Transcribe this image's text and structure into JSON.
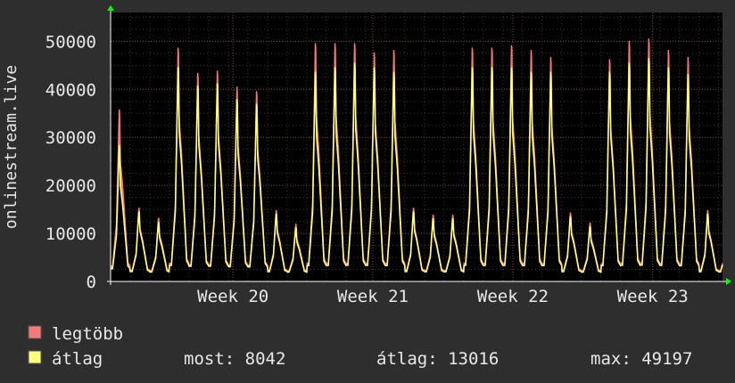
{
  "chart_data": {
    "type": "area",
    "ylabel": "onlinestream.live",
    "ylim": [
      0,
      56000
    ],
    "yticks": [
      0,
      10000,
      20000,
      30000,
      40000,
      50000
    ],
    "xlim": [
      0,
      31.2
    ],
    "xticks": [
      {
        "label": "Week 20",
        "x": 6.24
      },
      {
        "label": "Week 21",
        "x": 13.37
      },
      {
        "label": "Week 22",
        "x": 20.51
      },
      {
        "label": "Week 23",
        "x": 27.64
      }
    ],
    "grid": true,
    "colors": {
      "background": "#2e2e2e",
      "plot": "#000000",
      "grid": "#6a4444",
      "max": "#f47b7b",
      "avg": "#fdfd7e",
      "axis_arrow": "#00ff00"
    },
    "series": [
      {
        "name": "legtöbb",
        "color": "#f47b7b"
      },
      {
        "name": "átlag",
        "color": "#fdfd7e"
      }
    ],
    "days": [
      {
        "day": 0,
        "peak_max": 37500,
        "peak_avg": 30000
      },
      {
        "day": 1,
        "peak_max": 16000,
        "peak_avg": 15500
      },
      {
        "day": 2,
        "peak_max": 13800,
        "peak_avg": 13200
      },
      {
        "day": 3,
        "peak_max": 51000,
        "peak_avg": 47000
      },
      {
        "day": 4,
        "peak_max": 45500,
        "peak_avg": 43000
      },
      {
        "day": 5,
        "peak_max": 46000,
        "peak_avg": 43500
      },
      {
        "day": 6,
        "peak_max": 42500,
        "peak_avg": 40000
      },
      {
        "day": 7,
        "peak_max": 41500,
        "peak_avg": 39000
      },
      {
        "day": 8,
        "peak_max": 15500,
        "peak_avg": 15000
      },
      {
        "day": 9,
        "peak_max": 12500,
        "peak_avg": 12000
      },
      {
        "day": 10,
        "peak_max": 52000,
        "peak_avg": 46000
      },
      {
        "day": 11,
        "peak_max": 52000,
        "peak_avg": 47000
      },
      {
        "day": 12,
        "peak_max": 52000,
        "peak_avg": 48000
      },
      {
        "day": 13,
        "peak_max": 50000,
        "peak_avg": 47000
      },
      {
        "day": 14,
        "peak_max": 50500,
        "peak_avg": 46000
      },
      {
        "day": 15,
        "peak_max": 16000,
        "peak_avg": 15500
      },
      {
        "day": 16,
        "peak_max": 14500,
        "peak_avg": 14000
      },
      {
        "day": 17,
        "peak_max": 14500,
        "peak_avg": 14000
      },
      {
        "day": 18,
        "peak_max": 51000,
        "peak_avg": 47000
      },
      {
        "day": 19,
        "peak_max": 51000,
        "peak_avg": 47000
      },
      {
        "day": 20,
        "peak_max": 51500,
        "peak_avg": 47000
      },
      {
        "day": 21,
        "peak_max": 50500,
        "peak_avg": 46000
      },
      {
        "day": 22,
        "peak_max": 49000,
        "peak_avg": 46000
      },
      {
        "day": 23,
        "peak_max": 15000,
        "peak_avg": 14500
      },
      {
        "day": 24,
        "peak_max": 12800,
        "peak_avg": 12300
      },
      {
        "day": 25,
        "peak_max": 48500,
        "peak_avg": 46000
      },
      {
        "day": 26,
        "peak_max": 52500,
        "peak_avg": 48000
      },
      {
        "day": 27,
        "peak_max": 53000,
        "peak_avg": 49000
      },
      {
        "day": 28,
        "peak_max": 50500,
        "peak_avg": 47000
      },
      {
        "day": 29,
        "peak_max": 49000,
        "peak_avg": 45500
      },
      {
        "day": 30,
        "peak_max": 15500,
        "peak_avg": 15000
      },
      {
        "day": 31,
        "peak_max": 14000,
        "peak_avg": 13500
      }
    ]
  },
  "legend": {
    "max_label": "legtöbb",
    "avg_label": "átlag",
    "now_text": "most: 8042",
    "avg_text": "átlag: 13016",
    "max_text": "max: 49197"
  }
}
